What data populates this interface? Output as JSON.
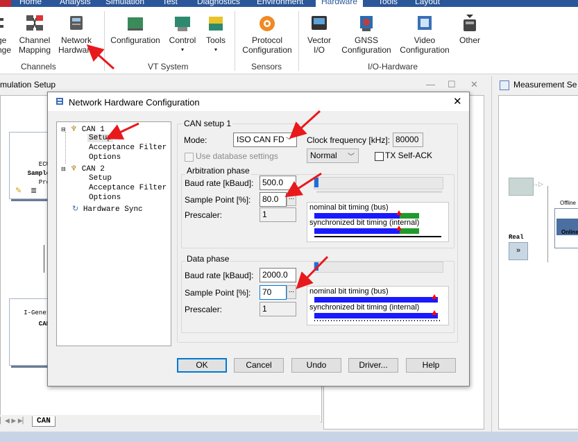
{
  "ribbon": {
    "tabs": [
      "Home",
      "Analysis",
      "Simulation",
      "Test",
      "Diagnostics",
      "Environment",
      "Hardware",
      "Tools",
      "Layout"
    ],
    "active_tab": "Hardware",
    "buttons": {
      "partial1": "ge",
      "partial2": "nge",
      "channel_mapping_1": "Channel",
      "channel_mapping_2": "Mapping",
      "network_hw_1": "Network",
      "network_hw_2": "Hardware",
      "configuration": "Configuration",
      "control": "Control",
      "tools": "Tools",
      "protocol_1": "Protocol",
      "protocol_2": "Configuration",
      "vector_1": "Vector",
      "vector_2": "I/O",
      "gnss_1": "GNSS",
      "gnss_2": "Configuration",
      "video_1": "Video",
      "video_2": "Configuration",
      "other": "Other"
    },
    "groups": {
      "channels": "Channels",
      "vt_system": "VT System",
      "sensors": "Sensors",
      "io_hardware": "I/O-Hardware"
    }
  },
  "bg": {
    "sim_title": "mulation Setup",
    "meas_title": "Measurement Se",
    "ecu_1": "ECU",
    "ecu_2": "Sample",
    "ecu_3": "Pro",
    "igen_1": "I-Gener",
    "igen_2": "CAN",
    "offline": "Offline",
    "online": "Online",
    "real": "Real",
    "can_tab": "CAN"
  },
  "dialog": {
    "title": "Network Hardware Configuration",
    "tree": {
      "can1": "CAN 1",
      "can1_setup": "Setup",
      "can1_accept": "Acceptance Filter",
      "can1_options": "Options",
      "can2": "CAN 2",
      "can2_setup": "Setup",
      "can2_accept": "Acceptance Filter",
      "can2_options": "Options",
      "hw_sync": "Hardware Sync"
    },
    "setup_group": "CAN setup 1",
    "mode_label": "Mode:",
    "mode_value": "ISO CAN FD",
    "clock_label": "Clock frequency [kHz]:",
    "clock_value": "80000",
    "use_db_label": "Use database settings",
    "normal_value": "Normal",
    "tx_self_ack": "TX Self-ACK",
    "arb": {
      "group": "Arbitration phase",
      "baud_label": "Baud rate [kBaud]:",
      "baud_value": "500.0",
      "sp_label": "Sample Point [%]:",
      "sp_value": "80.0",
      "presc_label": "Prescaler:",
      "presc_value": "1",
      "nominal": "nominal bit timing (bus)",
      "sync": "synchronized bit timing (internal)",
      "sample_point_pct": 80
    },
    "data": {
      "group": "Data phase",
      "baud_label": "Baud rate [kBaud]:",
      "baud_value": "2000.0",
      "sp_label": "Sample Point [%]:",
      "sp_value": "70",
      "presc_label": "Prescaler:",
      "presc_value": "1",
      "nominal": "nominal bit timing (bus)",
      "sync": "synchronized bit timing (internal)"
    },
    "dots": "...",
    "buttons": {
      "ok": "OK",
      "cancel": "Cancel",
      "undo": "Undo",
      "driver": "Driver...",
      "help": "Help"
    }
  },
  "colors": {
    "accent": "#2b579a",
    "arrow": "#e8191c",
    "bar_blue": "#1a1aff",
    "bar_green": "#1f9b2c",
    "marker_red": "#ff0000"
  }
}
